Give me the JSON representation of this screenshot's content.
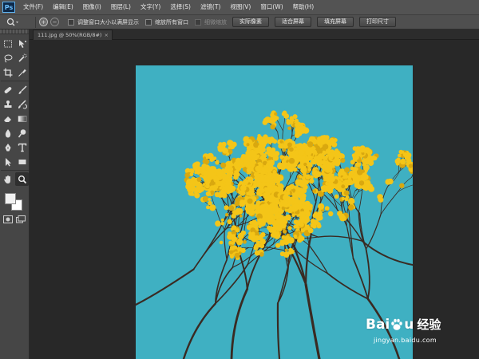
{
  "app": {
    "logo_text": "Ps"
  },
  "menu": {
    "items": [
      {
        "label": "文件(F)"
      },
      {
        "label": "编辑(E)"
      },
      {
        "label": "图像(I)"
      },
      {
        "label": "图层(L)"
      },
      {
        "label": "文字(Y)"
      },
      {
        "label": "选择(S)"
      },
      {
        "label": "滤镜(T)"
      },
      {
        "label": "视图(V)"
      },
      {
        "label": "窗口(W)"
      },
      {
        "label": "帮助(H)"
      }
    ]
  },
  "options": {
    "zoom_in_symbol": "+",
    "zoom_out_symbol": "−",
    "checkboxes": [
      {
        "label": "调整窗口大小以满屏显示",
        "checked": false,
        "enabled": true
      },
      {
        "label": "缩放所有窗口",
        "checked": false,
        "enabled": true
      },
      {
        "label": "细微缩放",
        "checked": false,
        "enabled": false
      }
    ],
    "buttons": [
      {
        "label": "实际像素"
      },
      {
        "label": "适合屏幕"
      },
      {
        "label": "填充屏幕"
      },
      {
        "label": "打印尺寸"
      }
    ]
  },
  "document": {
    "tab_title": "111.jpg @ 50%(RGB/8#)",
    "close_symbol": "×"
  },
  "watermark": {
    "brand_a": "Bai",
    "brand_b": "u",
    "brand_cn": "经验",
    "url": "jingyan.baidu.com"
  },
  "colors": {
    "sky": "#3fb0c2",
    "blossom": "#f4c518",
    "branch": "#3a2a22",
    "ps_logo_accent": "#5fb3f0"
  },
  "tools": [
    "marquee-icon",
    "move-icon",
    "lasso-icon",
    "quick-select-icon",
    "crop-icon",
    "eyedropper-icon",
    "healing-icon",
    "brush-icon",
    "stamp-icon",
    "history-brush-icon",
    "eraser-icon",
    "gradient-icon",
    "blur-icon",
    "dodge-icon",
    "pen-icon",
    "type-icon",
    "path-select-icon",
    "rectangle-icon",
    "hand-icon",
    "zoom-icon"
  ]
}
